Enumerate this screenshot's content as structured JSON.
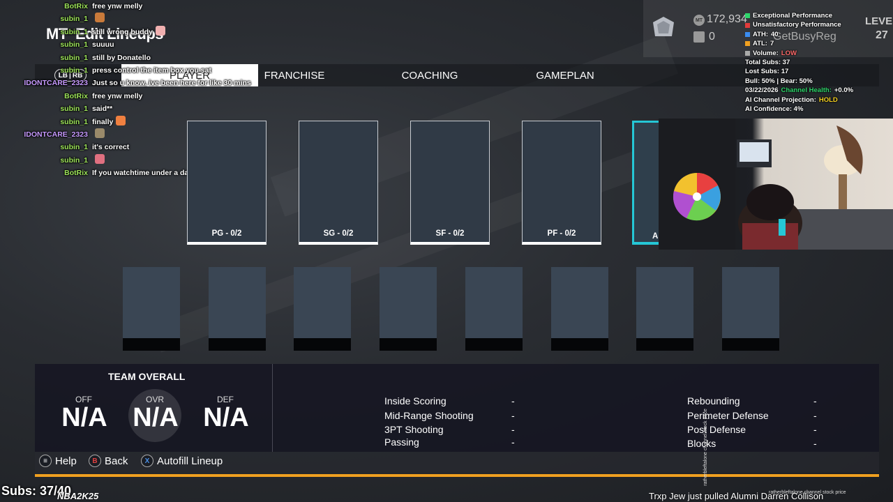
{
  "page": {
    "title": "Edit Lineups",
    "title_prefix": "MT"
  },
  "tabs": [
    {
      "label": "PLAYER",
      "active": true
    },
    {
      "label": "FRANCHISE",
      "active": false
    },
    {
      "label": "COACHING",
      "active": false
    },
    {
      "label": "GAMEPLAN",
      "active": false
    }
  ],
  "bumper_hint": {
    "left": "LB",
    "right": "RB"
  },
  "mt_header": {
    "mt_amount": "172,934",
    "tokens": "0",
    "gamertag": "GetBusyReg",
    "level_label": "LEVEL",
    "level_value": "27",
    "coin_icon": "mt-coin-icon",
    "token_icon": "token-icon"
  },
  "stream_stats": {
    "legend": [
      {
        "label": "Exceptional Performance",
        "color": "#2ed66b"
      },
      {
        "label": "Unsatisfactory Performance",
        "color": "#e23b3b"
      }
    ],
    "ath": {
      "label": "ATH:",
      "value": "40",
      "color": "#3a8cf0"
    },
    "atl": {
      "label": "ATL:",
      "value": "7",
      "color": "#f0a020"
    },
    "volume": {
      "label": "Volume:",
      "value": "LOW",
      "color": "#aaaaaa",
      "value_color": "#ff6b6b"
    },
    "total_subs": "Total Subs: 37",
    "lost_subs": "Lost Subs: 17",
    "bull_bear": "Bull: 50% | Bear: 50%",
    "date": "03/22/2026",
    "channel_health_label": "Channel Health:",
    "channel_health_value": "+0.0%",
    "projection_label": "AI Channel Projection:",
    "projection_value": "HOLD",
    "confidence": "AI Confidence: 4%"
  },
  "chat": [
    {
      "user": "BotRix",
      "text": "free ynw melly",
      "color": "u-green"
    },
    {
      "user": "subin_1",
      "text": "",
      "color": "u-green",
      "emote": "#c97a3a"
    },
    {
      "user": "subin_1",
      "text": "still wrong buddy",
      "color": "u-green",
      "emote": "#f0b0b0"
    },
    {
      "user": "subin_1",
      "text": "suuuu",
      "color": "u-green"
    },
    {
      "user": "subin_1",
      "text": "still by Donatello",
      "color": "u-green"
    },
    {
      "user": "subin_1",
      "text": "press control the item box you sat",
      "color": "u-green"
    },
    {
      "user": "IDONTCARE_2323",
      "text": "Just so u know, ive been here for like 30 mins",
      "color": "u-purple"
    },
    {
      "user": "BotRix",
      "text": "free ynw melly",
      "color": "u-green"
    },
    {
      "user": "subin_1",
      "text": "said**",
      "color": "u-green"
    },
    {
      "user": "subin_1",
      "text": "finally",
      "color": "u-green",
      "emote": "#f08040"
    },
    {
      "user": "IDONTCARE_2323",
      "text": "",
      "color": "u-purple",
      "emote": "#9a8a6a"
    },
    {
      "user": "subin_1",
      "text": "it's correct",
      "color": "u-green"
    },
    {
      "user": "subin_1",
      "text": "",
      "color": "u-green",
      "emote": "#e07080"
    },
    {
      "user": "BotRix",
      "text": "If you watchtime under a day u a bitch",
      "color": "u-green"
    }
  ],
  "starters": [
    {
      "pos": "PG - 0/2"
    },
    {
      "pos": "SG - 0/2"
    },
    {
      "pos": "SF - 0/2"
    },
    {
      "pos": "PF - 0/2"
    },
    {
      "pos": "A"
    }
  ],
  "bench_count_note": "8",
  "team_overall": {
    "title": "TEAM OVERALL",
    "off_label": "OFF",
    "off_value": "N/A",
    "ovr_label": "OVR",
    "ovr_value": "N/A",
    "def_label": "DEF",
    "def_value": "N/A"
  },
  "attributes_left": [
    {
      "label": "Inside Scoring",
      "value": "-"
    },
    {
      "label": "Mid-Range Shooting",
      "value": "-"
    },
    {
      "label": "3PT Shooting",
      "value": "-"
    },
    {
      "label": "Passing",
      "value": "-"
    }
  ],
  "attributes_right": [
    {
      "label": "Rebounding",
      "value": "-"
    },
    {
      "label": "Perimeter Defense",
      "value": "-"
    },
    {
      "label": "Post Defense",
      "value": "-"
    },
    {
      "label": "Blocks",
      "value": "-"
    }
  ],
  "footer": {
    "help": "Help",
    "help_icon": "≡",
    "back": "Back",
    "back_icon": "B",
    "autofill": "Autofill Lineup",
    "autofill_icon": "X"
  },
  "overlay_bottom": {
    "subs": "Subs: 37/40",
    "nba_logo": "NBA2K25",
    "ticker": "Trxp Jew just pulled Alumni Darren Collison",
    "ticker_small": "ratherbleftalone channel stock price",
    "ticker_vertical": "ratherbleftalone channel stock price"
  }
}
